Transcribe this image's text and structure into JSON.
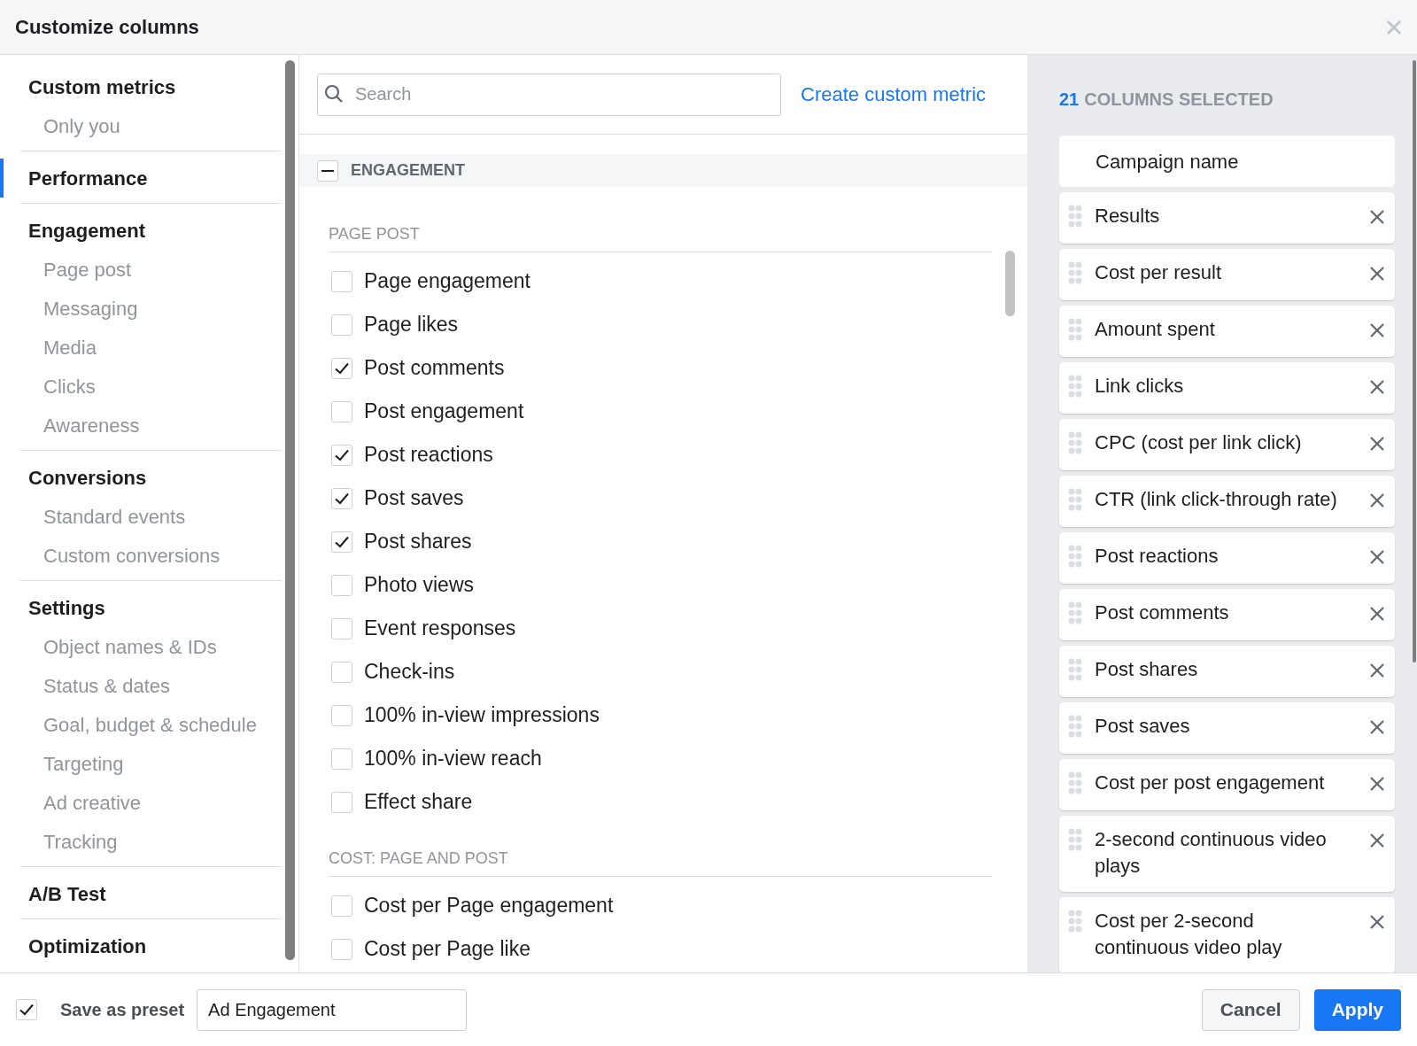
{
  "window": {
    "title": "Customize columns"
  },
  "sidebar": {
    "sections": [
      {
        "label": "Custom metrics",
        "selected": false,
        "items": [
          "Only you"
        ]
      },
      {
        "label": "Performance",
        "selected": true
      },
      {
        "label": "Engagement",
        "selected": false,
        "items": [
          "Page post",
          "Messaging",
          "Media",
          "Clicks",
          "Awareness"
        ]
      },
      {
        "label": "Conversions",
        "selected": false,
        "items": [
          "Standard events",
          "Custom conversions"
        ]
      },
      {
        "label": "Settings",
        "selected": false,
        "items": [
          "Object names & IDs",
          "Status & dates",
          "Goal, budget & schedule",
          "Targeting",
          "Ad creative",
          "Tracking"
        ]
      },
      {
        "label": "A/B Test",
        "selected": false
      },
      {
        "label": "Optimization",
        "selected": false
      }
    ]
  },
  "search": {
    "placeholder": "Search"
  },
  "create_link": "Create custom metric",
  "group": {
    "label": "ENGAGEMENT",
    "expanded": true,
    "subgroups": [
      {
        "label": "PAGE POST",
        "metrics": [
          {
            "label": "Page engagement",
            "checked": false
          },
          {
            "label": "Page likes",
            "checked": false
          },
          {
            "label": "Post comments",
            "checked": true
          },
          {
            "label": "Post engagement",
            "checked": false
          },
          {
            "label": "Post reactions",
            "checked": true
          },
          {
            "label": "Post saves",
            "checked": true
          },
          {
            "label": "Post shares",
            "checked": true
          },
          {
            "label": "Photo views",
            "checked": false
          },
          {
            "label": "Event responses",
            "checked": false
          },
          {
            "label": "Check-ins",
            "checked": false
          },
          {
            "label": "100% in-view impressions",
            "checked": false
          },
          {
            "label": "100% in-view reach",
            "checked": false
          },
          {
            "label": "Effect share",
            "checked": false
          }
        ]
      },
      {
        "label": "COST: PAGE AND POST",
        "metrics": [
          {
            "label": "Cost per Page engagement",
            "checked": false
          },
          {
            "label": "Cost per Page like",
            "checked": false
          }
        ]
      }
    ]
  },
  "selected_panel": {
    "count": "21",
    "label": "COLUMNS SELECTED",
    "columns": [
      {
        "label": "Campaign name",
        "kind": "fixed"
      },
      {
        "label": "Results",
        "kind": "removable"
      },
      {
        "label": "Cost per result",
        "kind": "removable"
      },
      {
        "label": "Amount spent",
        "kind": "removable"
      },
      {
        "label": "Link clicks",
        "kind": "removable"
      },
      {
        "label": "CPC (cost per link click)",
        "kind": "removable"
      },
      {
        "label": "CTR (link click-through rate)",
        "kind": "removable"
      },
      {
        "label": "Post reactions",
        "kind": "removable"
      },
      {
        "label": "Post comments",
        "kind": "removable"
      },
      {
        "label": "Post shares",
        "kind": "removable"
      },
      {
        "label": "Post saves",
        "kind": "removable"
      },
      {
        "label": "Cost per post engagement",
        "kind": "removable"
      },
      {
        "label": "2-second continuous video plays",
        "kind": "removable"
      },
      {
        "label": "Cost per 2-second continuous video play",
        "kind": "removable"
      }
    ]
  },
  "footer": {
    "save_preset": {
      "label": "Save as preset",
      "checked": true
    },
    "preset_name": "Ad Engagement",
    "buttons": [
      "Cancel",
      "Apply"
    ]
  }
}
